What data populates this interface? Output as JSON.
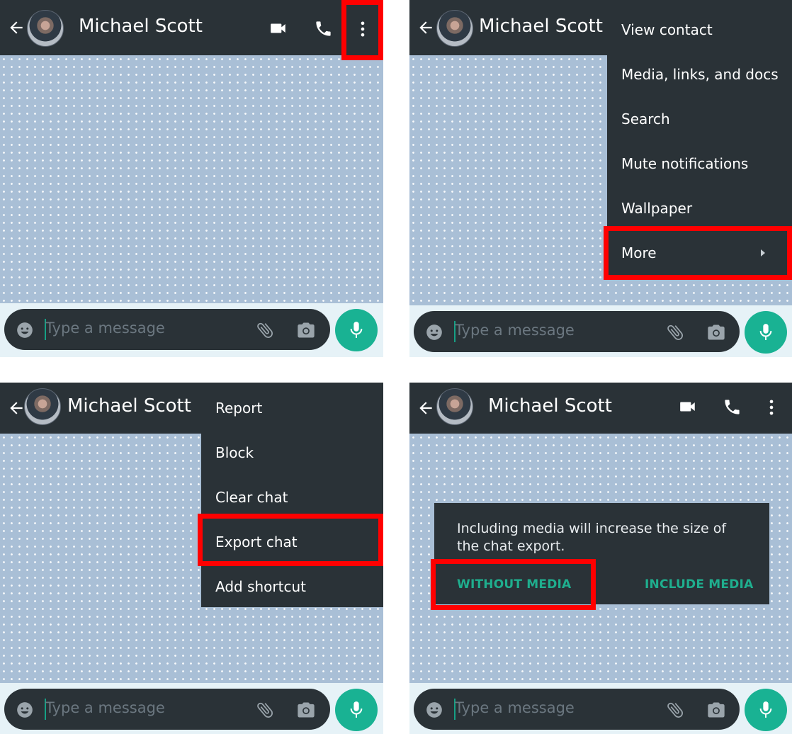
{
  "contact_name": "Michael Scott",
  "composer": {
    "placeholder": "Type a message"
  },
  "menu_main": {
    "items": [
      {
        "label": "View contact"
      },
      {
        "label": "Media, links, and docs"
      },
      {
        "label": "Search"
      },
      {
        "label": "Mute notifications"
      },
      {
        "label": "Wallpaper"
      },
      {
        "label": "More"
      }
    ]
  },
  "menu_more": {
    "items": [
      {
        "label": "Report"
      },
      {
        "label": "Block"
      },
      {
        "label": "Clear chat"
      },
      {
        "label": "Export chat"
      },
      {
        "label": "Add shortcut"
      }
    ]
  },
  "export_dialog": {
    "message": "Including media will increase the size of the chat export.",
    "without_media": "WITHOUT MEDIA",
    "include_media": "INCLUDE MEDIA"
  },
  "icons": {
    "back": "arrow-left-icon",
    "video": "video-camera-icon",
    "call": "phone-icon",
    "overflow": "more-vertical-icon",
    "emoji": "emoji-icon",
    "attach": "paperclip-icon",
    "camera": "camera-icon",
    "mic": "microphone-icon",
    "submenu": "chevron-right-icon"
  },
  "colors": {
    "header": "#2a3237",
    "chat_background": "#a9bfd6",
    "accent": "#19b293",
    "highlight": "#ff0000"
  }
}
